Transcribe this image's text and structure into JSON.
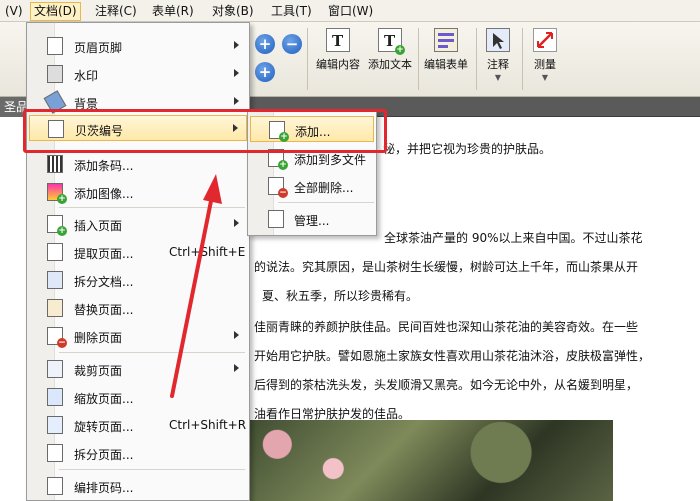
{
  "menubar": {
    "items": [
      {
        "label": "(V)"
      },
      {
        "label": "文档(D)"
      },
      {
        "label": "注释(C)"
      },
      {
        "label": "表单(R)"
      },
      {
        "label": "对象(B)"
      },
      {
        "label": "工具(T)"
      },
      {
        "label": "窗口(W)"
      }
    ],
    "active_index": 1
  },
  "toolbar": {
    "buttons": [
      {
        "label": "编辑内容",
        "icon": "edit-content-icon"
      },
      {
        "label": "添加文本",
        "icon": "add-text-icon"
      },
      {
        "label": "编辑表单",
        "icon": "edit-form-icon"
      },
      {
        "label": "注释",
        "icon": "comment-icon"
      },
      {
        "label": "测量",
        "icon": "measure-icon"
      }
    ],
    "zoom_in": "+",
    "zoom_out": "−"
  },
  "tab": {
    "label": "圣品"
  },
  "document_menu": {
    "items": [
      {
        "label": "页眉页脚",
        "icon": "header-footer-icon",
        "submenu": true
      },
      {
        "label": "水印",
        "icon": "watermark-icon",
        "submenu": true
      },
      {
        "label": "背景",
        "icon": "background-icon",
        "submenu": true
      },
      {
        "label": "贝茨编号",
        "icon": "bates-number-icon",
        "submenu": true,
        "highlighted": true
      },
      {
        "label": "添加条码...",
        "icon": "barcode-icon"
      },
      {
        "label": "添加图像...",
        "icon": "add-image-icon"
      },
      {
        "label": "插入页面",
        "icon": "insert-page-icon",
        "submenu": true
      },
      {
        "label": "提取页面...",
        "icon": "extract-page-icon",
        "shortcut": "Ctrl+Shift+E"
      },
      {
        "label": "拆分文档...",
        "icon": "split-document-icon"
      },
      {
        "label": "替换页面...",
        "icon": "replace-page-icon"
      },
      {
        "label": "删除页面",
        "icon": "delete-page-icon",
        "submenu": true
      },
      {
        "label": "裁剪页面",
        "icon": "crop-page-icon",
        "submenu": true
      },
      {
        "label": "缩放页面...",
        "icon": "scale-page-icon"
      },
      {
        "label": "旋转页面...",
        "icon": "rotate-page-icon",
        "shortcut": "Ctrl+Shift+R"
      },
      {
        "label": "拆分页面...",
        "icon": "split-page-icon"
      },
      {
        "label": "编排页码...",
        "icon": "page-numbering-icon"
      }
    ]
  },
  "bates_submenu": {
    "items": [
      {
        "label": "添加...",
        "icon": "bates-add-icon",
        "highlighted": true
      },
      {
        "label": "添加到多文件",
        "icon": "bates-add-multiple-icon"
      },
      {
        "label": "全部删除...",
        "icon": "bates-remove-all-icon"
      },
      {
        "label": "管理...",
        "icon": "bates-manage-icon"
      }
    ]
  },
  "document_text": {
    "line1": "秘，并把它视为珍贵的护肤品。",
    "line2": "全球茶油产量的 90%以上来自中国。不过山茶花",
    "line3": "的说法。究其原因，是山茶树生长缓慢，树龄可达上千年，而山茶果从开",
    "line4": "夏、秋五季，所以珍贵稀有。",
    "line5": "佳丽青睐的养颜护肤佳品。民间百姓也深知山茶花油的美容奇效。在一些",
    "line6": "开始用它护肤。譬如恩施土家族女性喜欢用山茶花油沐浴，皮肤极富弹性，",
    "line7": "后得到的茶枯洗头发，头发顺滑又黑亮。如今无论中外，从名媛到明星，",
    "line8": "油看作日常护肤护发的佳品。"
  },
  "colors": {
    "annotation": "#e0282e",
    "highlight": "#ffe9a8",
    "tab_background": "#5a5a5a"
  }
}
